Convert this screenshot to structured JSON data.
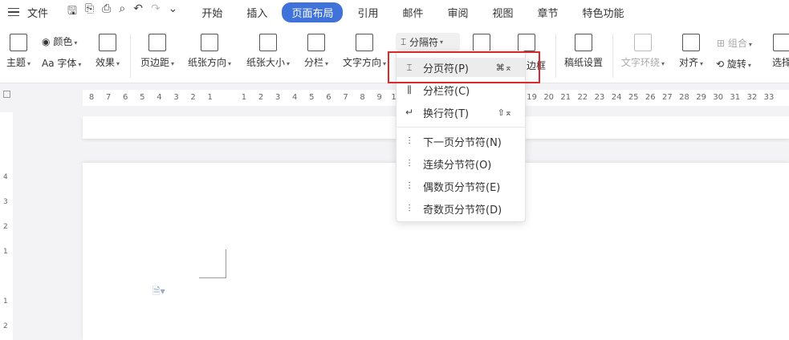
{
  "topbar": {
    "file_label": "文件",
    "tabs": [
      {
        "label": "开始"
      },
      {
        "label": "插入"
      },
      {
        "label": "页面布局"
      },
      {
        "label": "引用"
      },
      {
        "label": "邮件"
      },
      {
        "label": "审阅"
      },
      {
        "label": "视图"
      },
      {
        "label": "章节"
      },
      {
        "label": "特色功能"
      }
    ]
  },
  "ribbon": {
    "theme": "主题",
    "color": "颜色",
    "font": "字体",
    "font_prefix": "Aa",
    "effect": "效果",
    "margins": "页边距",
    "orientation": "纸张方向",
    "paper_size": "纸张大小",
    "columns": "分栏",
    "text_direction": "文字方向",
    "separator": "分隔符",
    "page_border_suffix": "边框",
    "manuscript": "稿纸设置",
    "wrap_text": "文字环绕",
    "align": "对齐",
    "rotate": "旋转",
    "group": "组合",
    "select": "选择"
  },
  "ruler": {
    "ticks": [
      "8",
      "7",
      "6",
      "5",
      "4",
      "3",
      "2",
      "1",
      "",
      "1",
      "2",
      "3",
      "4",
      "5",
      "6",
      "7",
      "8",
      "9",
      "10",
      "",
      "",
      "",
      "",
      "",
      "",
      "18",
      "19",
      "20",
      "21",
      "22",
      "23",
      "24",
      "25",
      "26",
      "27",
      "28",
      "29",
      "30",
      "31",
      "32",
      "33"
    ]
  },
  "vruler": {
    "ticks": [
      "4",
      "3",
      "2",
      "1",
      "",
      "1",
      "2"
    ]
  },
  "dropdown": {
    "items": [
      {
        "label": "分页符(P)",
        "shortcut": "⌘⌅"
      },
      {
        "label": "分栏符(C)",
        "shortcut": ""
      },
      {
        "label": "换行符(T)",
        "shortcut": "⇧⌅"
      },
      {
        "label": "下一页分节符(N)",
        "shortcut": ""
      },
      {
        "label": "连续分节符(O)",
        "shortcut": ""
      },
      {
        "label": "偶数页分节符(E)",
        "shortcut": ""
      },
      {
        "label": "奇数页分节符(D)",
        "shortcut": ""
      }
    ]
  },
  "colors": {
    "accent": "#3f73d9",
    "highlight_box": "#d92b2b"
  }
}
